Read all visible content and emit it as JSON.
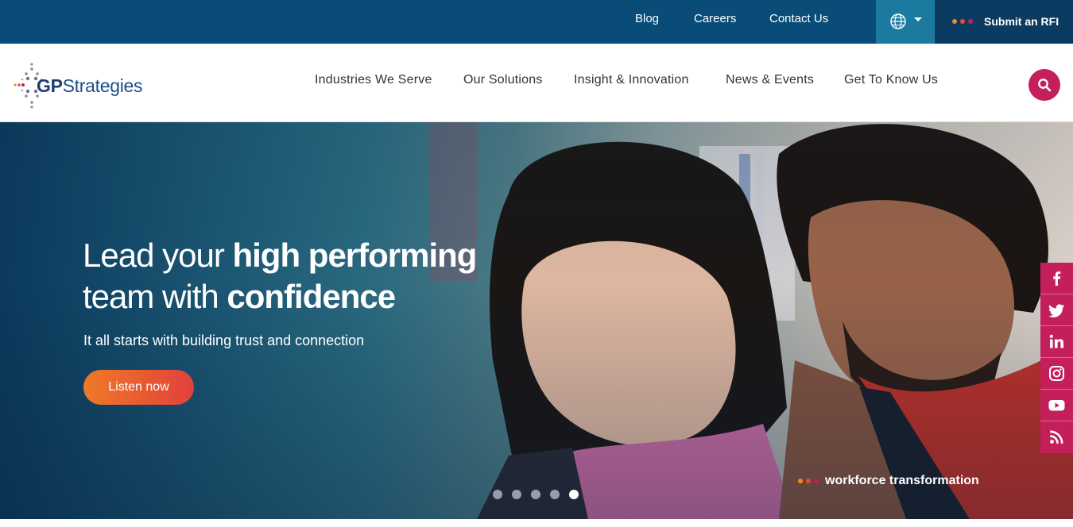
{
  "topbar": {
    "links": [
      "Blog",
      "Careers",
      "Contact Us"
    ],
    "rfi_label": "Submit an RFI",
    "globe_icon": "globe-icon"
  },
  "brand": {
    "logo_gp": "GP",
    "logo_rest": "Strategies",
    "dot_colors": [
      "#f28a1e",
      "#e8483b",
      "#c41f5b"
    ]
  },
  "nav": {
    "items": [
      "Industries We Serve",
      "Our Solutions",
      "Insight & Innovation",
      "News & Events",
      "Get To Know Us"
    ],
    "search_icon": "search-icon"
  },
  "hero": {
    "headline_line1_light": "Lead your ",
    "headline_line1_bold": "high performing",
    "headline_line2_light": "team with ",
    "headline_line2_bold": "confidence",
    "subheadline": "It all starts with building trust and connection",
    "cta_label": "Listen now",
    "tag": "workforce transformation",
    "slides": 5,
    "active_slide": 5
  },
  "social": [
    "facebook-icon",
    "twitter-icon",
    "linkedin-icon",
    "instagram-icon",
    "youtube-icon",
    "rss-icon"
  ],
  "colors": {
    "topbar": "#0a4c78",
    "accent": "#c41f5b",
    "cta_start": "#ee7a26",
    "cta_end": "#e2403d"
  }
}
